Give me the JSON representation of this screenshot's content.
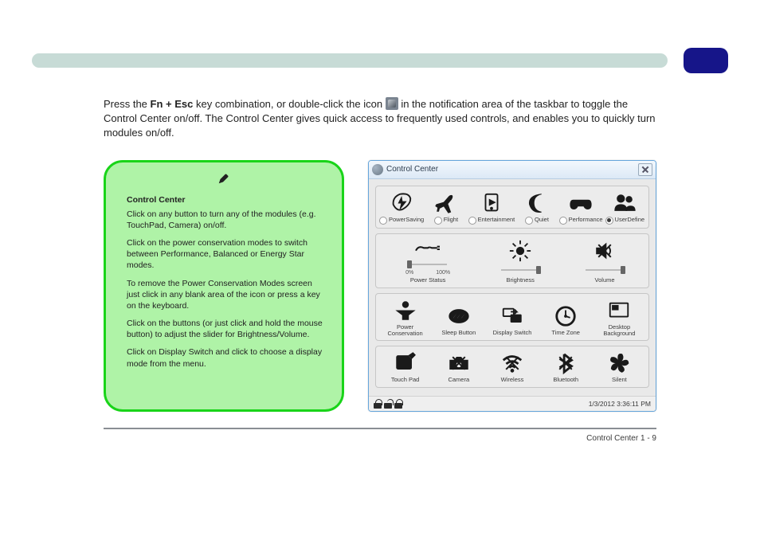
{
  "intro": {
    "pre": "Press the ",
    "keys": "Fn + Esc",
    "mid": " key combination, or double-click the icon ",
    "post": " in the notification area of the taskbar to toggle the Control Center on/off. The Control Center gives quick access to frequently used controls, and enables you to quickly turn modules on/off."
  },
  "note": {
    "title1": "Control Center",
    "p1a": "Click on any button to turn any of the modules (e.g. TouchPad, Camera) on/off.",
    "p1b": "Click on the power conservation modes to switch between Performance, Balanced or Energy Star modes.",
    "p1c": "To remove the Power Conservation Modes screen just click in any blank area of the icon or press a key on the keyboard.",
    "p2a": "Click on the buttons (or just click and hold the mouse button) to adjust the slider for Brightness/Volume.",
    "p2b": "Click on Display Switch and click to choose a display mode from the menu."
  },
  "cc": {
    "title": "Control Center",
    "modes": {
      "powersaving": "PowerSaving",
      "flight": "Flight",
      "entertainment": "Entertainment",
      "quiet": "Quiet",
      "performance": "Performance",
      "userdefine": "UserDefine"
    },
    "sliders": {
      "powerstatus": "Power Status",
      "brightness": "Brightness",
      "volume": "Volume",
      "ps_min": "0%",
      "ps_max": "100%"
    },
    "row3": {
      "powerconservation": "Power Conservation",
      "sleepbutton": "Sleep Button",
      "displayswitch": "Display Switch",
      "timezone": "Time Zone",
      "desktopbackground": "Desktop Background"
    },
    "row4": {
      "touchpad": "Touch Pad",
      "camera": "Camera",
      "wireless": "Wireless",
      "bluetooth": "Bluetooth",
      "silent": "Silent"
    },
    "timestamp": "1/3/2012 3:36:11 PM"
  },
  "footer": {
    "right": "Control Center 1 - 9",
    "num": ""
  }
}
